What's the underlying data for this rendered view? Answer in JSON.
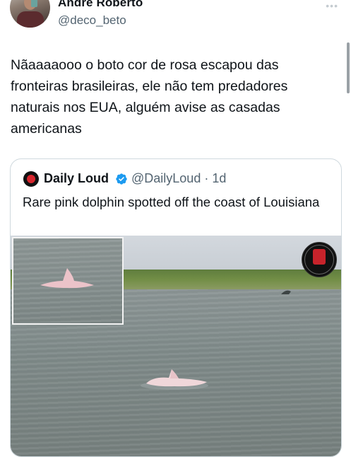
{
  "author": {
    "name": "André Roberto",
    "handle": "@deco_beto",
    "more_icon": "more-dots-icon"
  },
  "tweet": {
    "text": "Nãaaaaooo o boto cor de rosa escapou das fronteiras brasileiras, ele não tem predadores naturais nos EUA, alguém avise as casadas americanas"
  },
  "quoted": {
    "name": "Daily Loud",
    "handle_time": "@DailyLoud · 1d",
    "verified": true,
    "verified_color": "#1d9bf0",
    "text": "Rare pink dolphin spotted off the coast of Louisiana",
    "media": {
      "logo_icon": "daily-loud-logo",
      "subject": "pink-dolphin"
    }
  },
  "colors": {
    "text": "#0f1419",
    "secondary": "#536471",
    "border": "#cfd9de"
  }
}
